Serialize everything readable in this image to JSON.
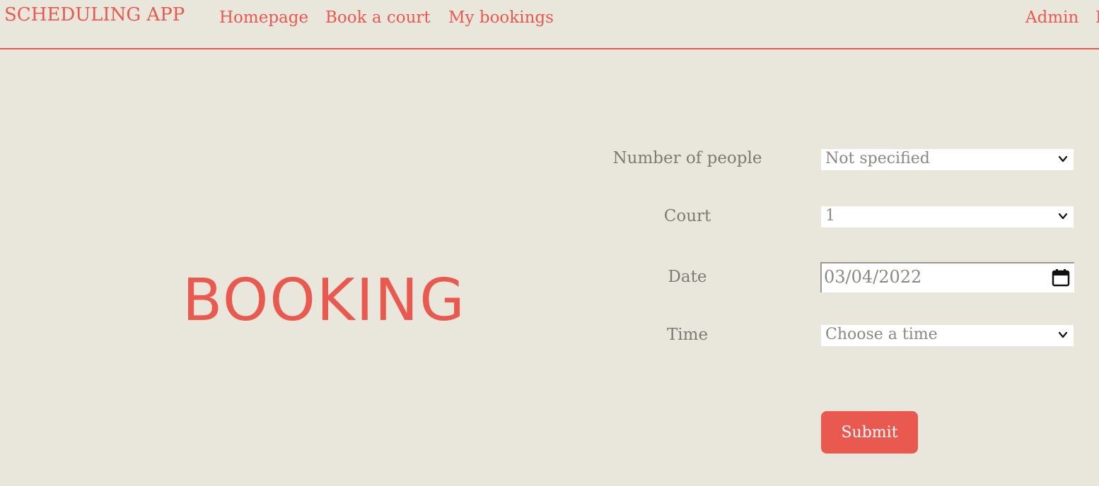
{
  "navbar": {
    "brand": "SCHEDULING APP",
    "links": [
      "Homepage",
      "Book a court",
      "My bookings"
    ],
    "right_link": "Admin",
    "cut_link": "L"
  },
  "hero": {
    "title": "BOOKING"
  },
  "form": {
    "people": {
      "label": "Number of people",
      "value": "Not specified"
    },
    "court": {
      "label": "Court",
      "value": "1"
    },
    "date": {
      "label": "Date",
      "value": "03/04/2022"
    },
    "time": {
      "label": "Time",
      "value": "Choose a time"
    },
    "submit_label": "Submit"
  },
  "colors": {
    "accent": "#e9594f",
    "background": "#e9e6dc",
    "label": "#7d7b74"
  },
  "icons": {
    "select_arrow": "chevron-down-icon",
    "date_picker": "calendar-icon"
  }
}
